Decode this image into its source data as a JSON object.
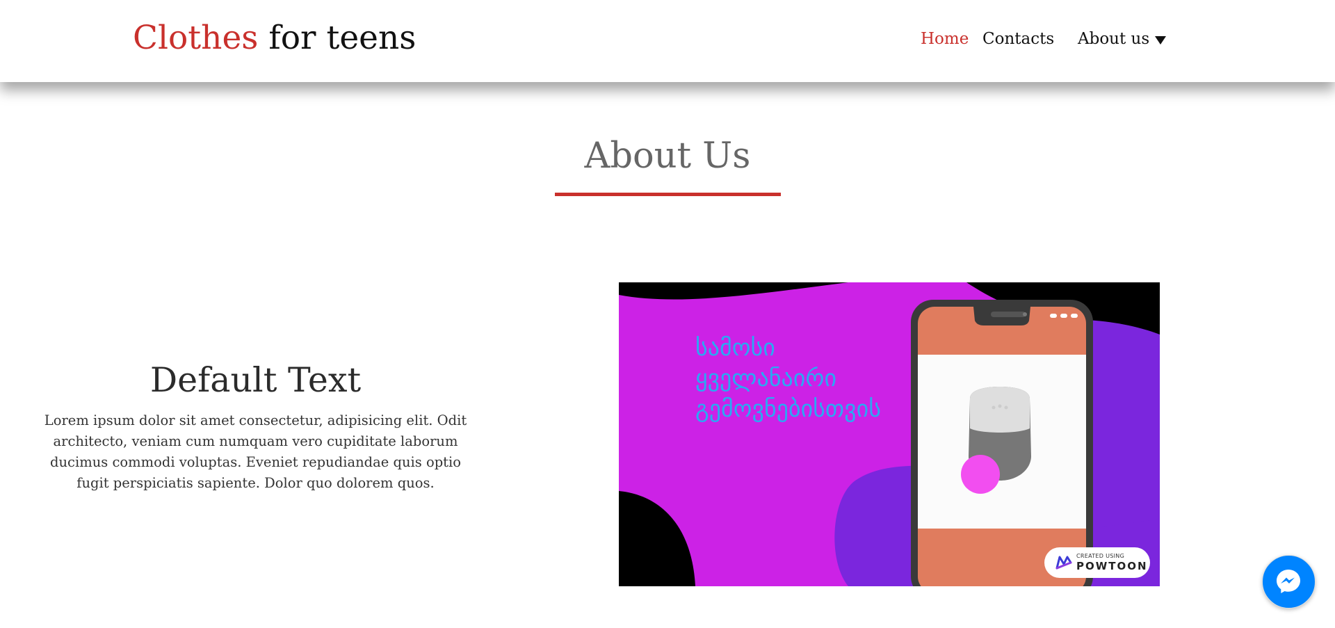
{
  "header": {
    "logo_part1": "Clothes",
    "logo_part2": "for teens",
    "nav": {
      "home": "Home",
      "contacts": "Contacts",
      "about": "About us"
    }
  },
  "about": {
    "title": "About Us"
  },
  "content": {
    "heading": "Default Text",
    "body": "Lorem ipsum dolor sit amet consectetur, adipisicing elit. Odit architecto, veniam cum numquam vero cupiditate laborum ducimus commodi voluptas. Eveniet repudiandae quis optio fugit perspiciatis sapiente. Dolor quo dolorem quos."
  },
  "video": {
    "text_lines": [
      "სამოსი",
      "ყველანაირი",
      "გემოვნებისთვის"
    ],
    "badge_small": "CREATED USING",
    "badge_brand": "POWTOON"
  },
  "colors": {
    "accent": "#c9302c",
    "title_gray": "#666666",
    "video_magenta": "#cc22e6",
    "video_purple": "#7b26dd",
    "phone_salmon": "#e07c5e",
    "georgian_text": "#2aa9f3",
    "messenger_blue": "#0084ff"
  },
  "icons": {
    "about_dropdown": "chevron-down-icon",
    "chat": "messenger-icon",
    "badge": "powtoon-logo-icon"
  }
}
